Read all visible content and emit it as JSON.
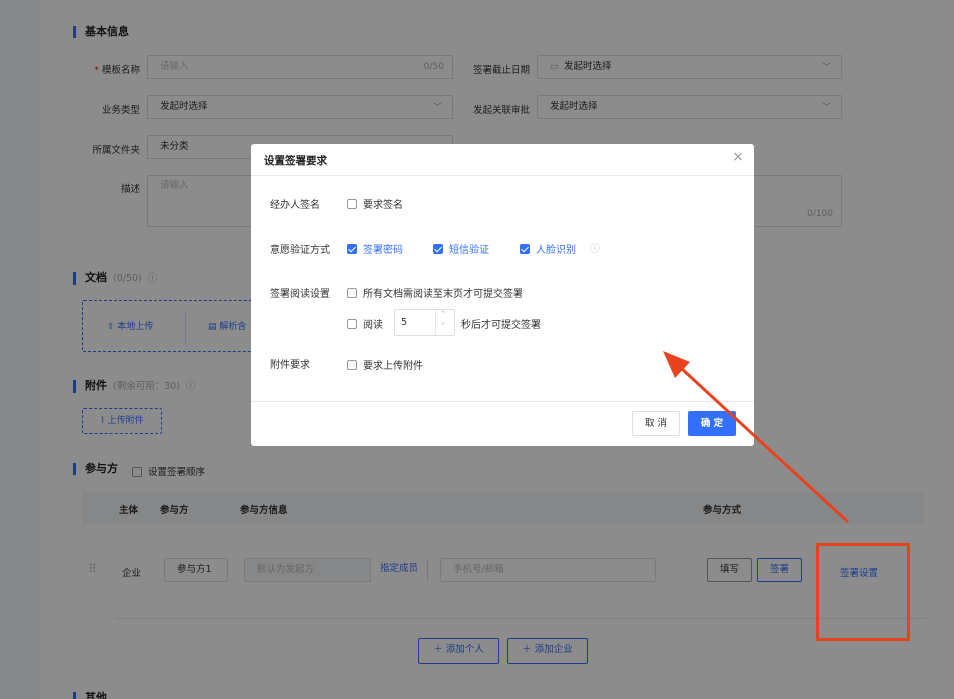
{
  "basic": {
    "section_title": "基本信息",
    "template_name_label": "模板名称",
    "required_mark": "*",
    "template_name_placeholder": "请输入",
    "template_name_count": "0/50",
    "deadline_label": "签署截止日期",
    "deadline_value": "发起时选择",
    "business_type_label": "业务类型",
    "business_type_value": "发起时选择",
    "linked_approval_label": "发起关联审批",
    "linked_approval_value": "发起时选择",
    "folder_label": "所属文件夹",
    "folder_value": "未分类",
    "desc_label": "描述",
    "desc_placeholder": "请输入",
    "desc_count": "0/100"
  },
  "docs": {
    "section_title": "文档",
    "count": "(0/50)",
    "local_upload": "本地上传",
    "parse_prefix": "解析含"
  },
  "attachments": {
    "section_title": "附件",
    "remaining": "(剩余可用：30)",
    "upload_button": "上传附件"
  },
  "participants": {
    "section_title": "参与方",
    "order_checkbox_label": "设置签署顺序",
    "columns": [
      "主体",
      "参与方",
      "参与方信息",
      "参与方式"
    ],
    "row": {
      "entity": "企业",
      "party_name": "参与方1",
      "default_placeholder": "默认为发起方",
      "assign_member": "指定成员",
      "contact_placeholder": "手机号/邮箱",
      "fill_tag": "填写",
      "sign_tag": "签署",
      "sign_settings_link": "签署设置"
    },
    "add_person": "添加个人",
    "add_company": "添加企业"
  },
  "other": {
    "section_title": "其他"
  },
  "modal": {
    "title": "设置签署要求",
    "handler_sign_label": "经办人签名",
    "handler_sign_option": "要求签名",
    "verify_label": "意愿验证方式",
    "verify_options": [
      {
        "label": "签署密码",
        "checked": true
      },
      {
        "label": "短信验证",
        "checked": true
      },
      {
        "label": "人脸识别",
        "checked": true
      }
    ],
    "reading_label": "签署阅读设置",
    "reading_option_all": "所有文档需阅读至末页才可提交签署",
    "reading_option_time_prefix": "阅读",
    "reading_seconds": "5",
    "reading_option_time_suffix": "秒后才可提交签署",
    "attachment_label": "附件要求",
    "attachment_option": "要求上传附件",
    "cancel_button": "取 消",
    "confirm_button": "确 定"
  },
  "colors": {
    "accent": "#3370ff",
    "annotation": "#e8431e"
  }
}
